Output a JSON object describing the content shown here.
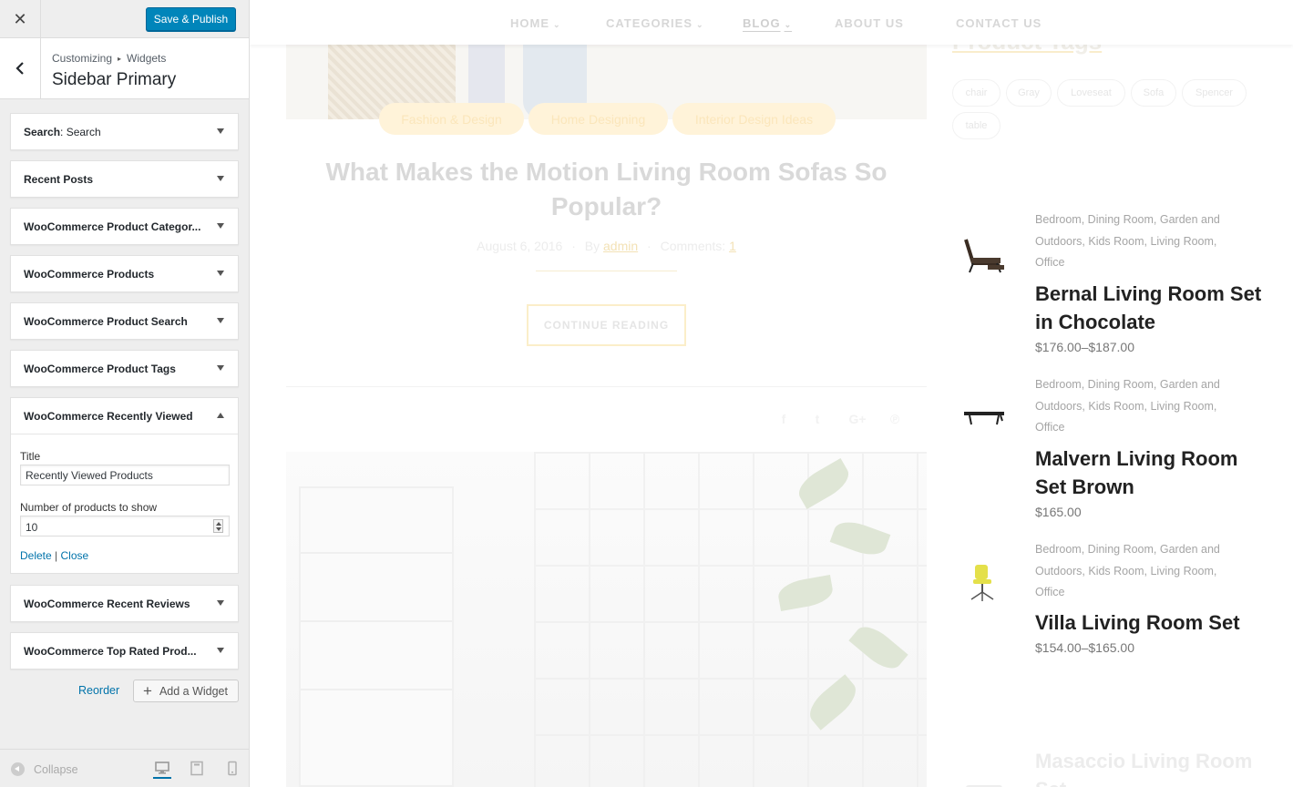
{
  "customizer": {
    "save_label": "Save & Publish",
    "breadcrumb": [
      "Customizing",
      "Widgets"
    ],
    "panel_title": "Sidebar Primary",
    "widgets_before": [
      {
        "title": "Search",
        "instance_title": ": Search"
      },
      {
        "title": "Recent Posts",
        "instance_title": ""
      },
      {
        "title": "WooCommerce Product Categor...",
        "instance_title": ""
      },
      {
        "title": "WooCommerce Products",
        "instance_title": ""
      },
      {
        "title": "WooCommerce Product Search",
        "instance_title": ""
      },
      {
        "title": "WooCommerce Product Tags",
        "instance_title": ""
      }
    ],
    "open_widget": {
      "title": "WooCommerce Recently Viewed",
      "title_label": "Title",
      "title_value": "Recently Viewed Products",
      "number_label": "Number of products to show",
      "number_value": "10",
      "delete_label": "Delete",
      "separator": "|",
      "close_label": "Close"
    },
    "widgets_after": [
      {
        "title": "WooCommerce Recent Reviews"
      },
      {
        "title": "WooCommerce Top Rated Prod..."
      }
    ],
    "reorder_label": "Reorder",
    "add_widget_label": "Add a Widget",
    "collapse_label": "Collapse"
  },
  "preview": {
    "nav": [
      {
        "label": "HOME",
        "has_dropdown": true,
        "active": false
      },
      {
        "label": "CATEGORIES",
        "has_dropdown": true,
        "active": false
      },
      {
        "label": "BLOG",
        "has_dropdown": true,
        "active": true
      },
      {
        "label": "ABOUT US",
        "has_dropdown": false,
        "active": false
      },
      {
        "label": "CONTACT US",
        "has_dropdown": false,
        "active": false
      }
    ],
    "post": {
      "categories": [
        "Fashion & Design",
        "Home Designing",
        "Interior Design Ideas"
      ],
      "title": "What Makes the Motion Living Room Sofas So Popular?",
      "date": "August 6, 2016",
      "by_label": "By",
      "author": "admin",
      "comments_label": "Comments:",
      "comments_count": "1",
      "continue_label": "CONTINUE READING"
    },
    "sidebar": {
      "tags_title": "Product Tags",
      "tags": [
        "chair",
        "Gray",
        "Loveseat",
        "Sofa",
        "Spencer",
        "table"
      ],
      "products": [
        {
          "categories": "Bedroom, Dining Room, Garden and Outdoors, Kids Room, Living Room, Office",
          "name": "Bernal Living Room Set in Chocolate",
          "price": "$176.00–$187.00",
          "thumb": "lounge-chair"
        },
        {
          "categories": "Bedroom, Dining Room, Garden and Outdoors, Kids Room, Living Room, Office",
          "name": "Malvern Living Room Set Brown",
          "price": "$165.00",
          "thumb": "coffee-table"
        },
        {
          "categories": "Bedroom, Dining Room, Garden and Outdoors, Kids Room, Living Room, Office",
          "name": "Villa Living Room Set",
          "price": "$154.00–$165.00",
          "thumb": "office-chair"
        },
        {
          "categories": "",
          "name": "Masaccio Living Room Set",
          "price": "",
          "thumb": "sofa"
        }
      ]
    }
  }
}
